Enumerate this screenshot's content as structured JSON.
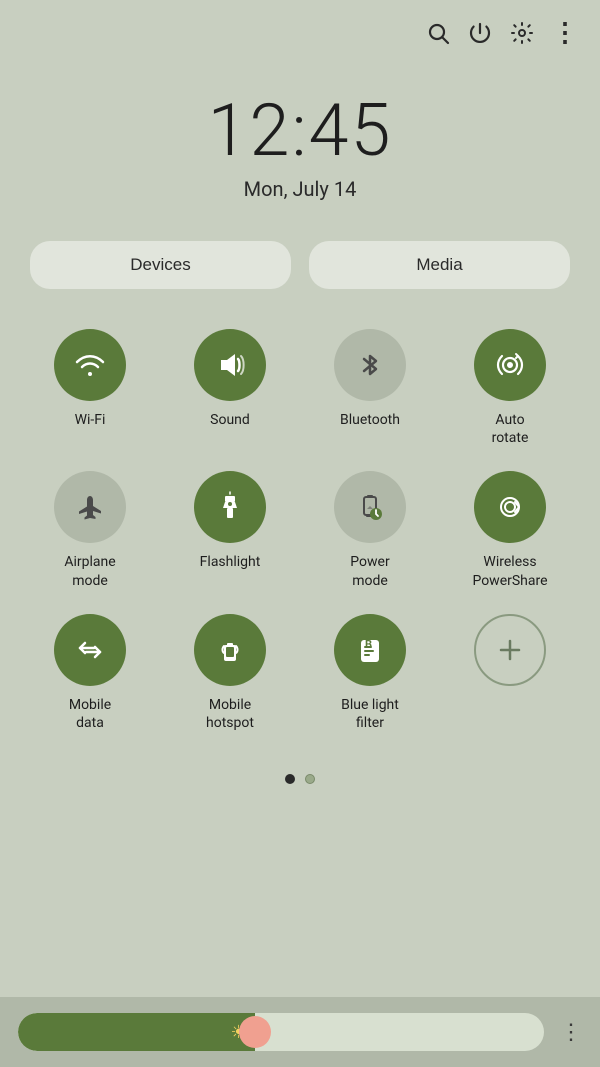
{
  "topIcons": {
    "search": "🔍",
    "power": "⏻",
    "settings": "⚙",
    "more": "⋮"
  },
  "clock": {
    "time": "12:45",
    "date": "Mon, July 14"
  },
  "deviceMediaRow": {
    "devices": "Devices",
    "media": "Media"
  },
  "tiles": [
    {
      "id": "wifi",
      "label": "Wi-Fi",
      "active": true,
      "icon": "wifi"
    },
    {
      "id": "sound",
      "label": "Sound",
      "active": true,
      "icon": "sound"
    },
    {
      "id": "bluetooth",
      "label": "Bluetooth",
      "active": false,
      "icon": "bluetooth"
    },
    {
      "id": "autorotate",
      "label": "Auto\nrotate",
      "active": true,
      "icon": "autorotate"
    },
    {
      "id": "airplanemode",
      "label": "Airplane\nmode",
      "active": false,
      "icon": "airplane"
    },
    {
      "id": "flashlight",
      "label": "Flashlight",
      "active": true,
      "icon": "flashlight"
    },
    {
      "id": "powermode",
      "label": "Power\nmode",
      "active": false,
      "icon": "powermode"
    },
    {
      "id": "wirelesspowershare",
      "label": "Wireless\nPowerShare",
      "active": true,
      "icon": "wireless"
    },
    {
      "id": "mobiledata",
      "label": "Mobile\ndata",
      "active": true,
      "icon": "mobiledata"
    },
    {
      "id": "mobilehotspot",
      "label": "Mobile\nhotspot",
      "active": true,
      "icon": "hotspot"
    },
    {
      "id": "bluelightfilter",
      "label": "Blue light\nfilter",
      "active": true,
      "icon": "bluelight"
    },
    {
      "id": "add",
      "label": "",
      "active": false,
      "icon": "add"
    }
  ],
  "pageDots": [
    "active",
    "inactive"
  ],
  "brightness": {
    "fillPercent": 45
  }
}
